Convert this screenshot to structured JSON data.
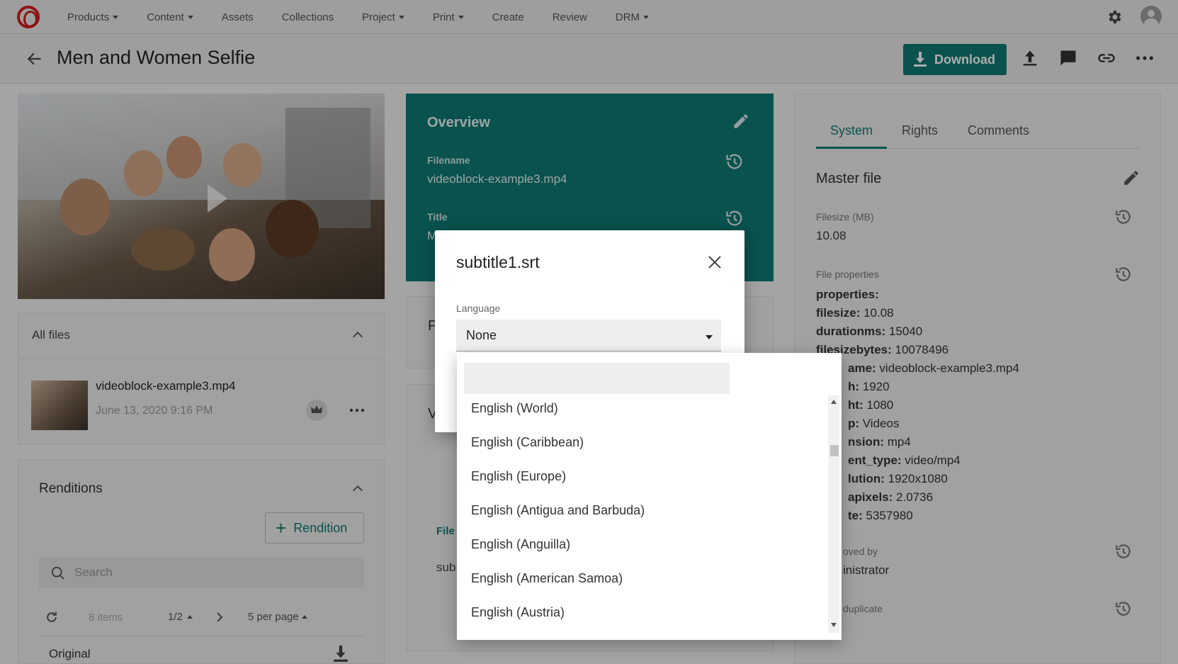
{
  "nav": {
    "items": [
      {
        "label": "Products",
        "has_caret": true
      },
      {
        "label": "Content",
        "has_caret": true
      },
      {
        "label": "Assets",
        "has_caret": false
      },
      {
        "label": "Collections",
        "has_caret": false
      },
      {
        "label": "Project",
        "has_caret": true
      },
      {
        "label": "Print",
        "has_caret": true
      },
      {
        "label": "Create",
        "has_caret": false
      },
      {
        "label": "Review",
        "has_caret": false
      },
      {
        "label": "DRM",
        "has_caret": true
      }
    ],
    "settings_icon": "gear-icon",
    "avatar_icon": "user-avatar-icon"
  },
  "header": {
    "title": "Men and Women Selfie",
    "download_label": "Download",
    "accent": "#0e7a73"
  },
  "all_files": {
    "title": "All files",
    "file": {
      "name": "videoblock-example3.mp4",
      "date": "June 13, 2020 9:16 PM"
    }
  },
  "renditions": {
    "title": "Renditions",
    "add_label": "Rendition",
    "search_placeholder": "Search",
    "items_count": "8 items",
    "page": "1/2",
    "per_page": "5 per page",
    "first_row": "Original"
  },
  "overview": {
    "title": "Overview",
    "filename_label": "Filename",
    "filename_value": "videoblock-example3.mp4",
    "title_label": "Title",
    "title_value": "M"
  },
  "middle_cards": {
    "card2_initial": "P",
    "card3_initial": "V",
    "col_header_partial": "File",
    "row_partial": "sub"
  },
  "right_panel": {
    "tabs": [
      "System",
      "Rights",
      "Comments"
    ],
    "active_tab": "System",
    "section_title": "Master file",
    "filesize_label": "Filesize (MB)",
    "filesize_value": "10.08",
    "file_properties_label": "File properties",
    "properties": [
      {
        "key": "properties:",
        "value": ""
      },
      {
        "key": "filesize:",
        "value": " 10.08"
      },
      {
        "key": "durationms:",
        "value": " 15040"
      },
      {
        "key": "filesizebytes:",
        "value": " 10078496"
      },
      {
        "key": "ame:",
        "value": " videoblock-example3.mp4"
      },
      {
        "key": "h:",
        "value": " 1920"
      },
      {
        "key": "ht:",
        "value": " 1080"
      },
      {
        "key": "p:",
        "value": " Videos"
      },
      {
        "key": "nsion:",
        "value": " mp4"
      },
      {
        "key": "ent_type:",
        "value": " video/mp4"
      },
      {
        "key": "lution:",
        "value": " 1920x1080"
      },
      {
        "key": "apixels:",
        "value": " 2.0736"
      },
      {
        "key": "te:",
        "value": " 5357980"
      }
    ],
    "approved_label": "oved by",
    "approved_value": "inistrator",
    "duplicate_label": "duplicate"
  },
  "dialog": {
    "title": "subtitle1.srt",
    "language_label": "Language",
    "language_value": "None",
    "search_value": "",
    "options": [
      "English (World)",
      "English (Caribbean)",
      "English (Europe)",
      "English (Antigua and Barbuda)",
      "English (Anguilla)",
      "English (American Samoa)",
      "English (Austria)"
    ]
  }
}
